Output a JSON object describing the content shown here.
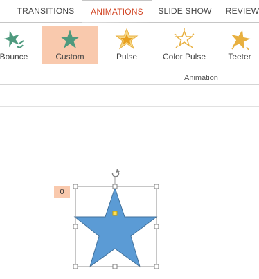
{
  "ribbon": {
    "tabs": [
      {
        "label": "TRANSITIONS",
        "active": false
      },
      {
        "label": "ANIMATIONS",
        "active": true
      },
      {
        "label": "SLIDE SHOW",
        "active": false
      },
      {
        "label": "REVIEW",
        "active": false
      }
    ],
    "gallery": [
      {
        "label": "Bounce",
        "icon": "bounce-star-icon",
        "selected": false
      },
      {
        "label": "Custom",
        "icon": "custom-star-icon",
        "selected": true
      },
      {
        "label": "Pulse",
        "icon": "pulse-star-icon",
        "selected": false
      },
      {
        "label": "Color Pulse",
        "icon": "color-pulse-star-icon",
        "selected": false
      },
      {
        "label": "Teeter",
        "icon": "teeter-star-icon",
        "selected": false
      }
    ],
    "group_label": "Animation"
  },
  "slide": {
    "animation_tag": "0",
    "shape": "star",
    "shape_color": "#5b9bd5"
  },
  "colors": {
    "accent": "#d24726",
    "selection": "#f9c9ad",
    "star_green": "#4e9a7e",
    "star_gold": "#e8b040"
  }
}
